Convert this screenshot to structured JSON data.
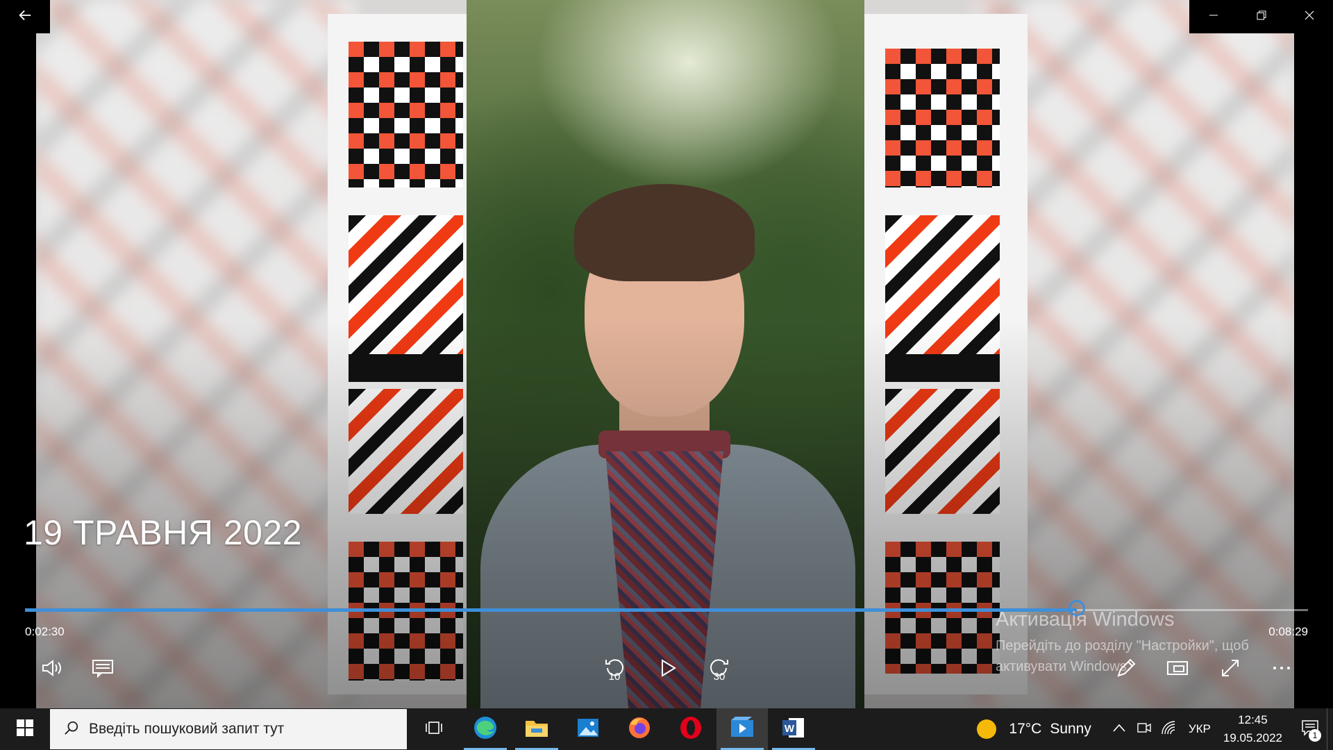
{
  "video": {
    "title": "19 ТРАВНЯ 2022",
    "current_time": "0:02:30",
    "total_time": "0:08:29",
    "progress_fraction": 0.82,
    "accent_color": "#3f8fd8",
    "skip_back_seconds": "10",
    "skip_forward_seconds": "30"
  },
  "window_controls": {
    "back_icon": "arrow-left-icon",
    "minimize_icon": "minimize-icon",
    "restore_icon": "restore-icon",
    "close_icon": "close-icon"
  },
  "player_controls": {
    "volume_icon": "volume-icon",
    "captions_icon": "captions-icon",
    "skip_back_icon": "skip-back-10-icon",
    "play_icon": "play-icon",
    "skip_forward_icon": "skip-forward-30-icon",
    "edit_icon": "pencil-icon",
    "miniview_icon": "mini-view-icon",
    "fullscreen_icon": "fullscreen-icon",
    "more_icon": "more-icon"
  },
  "activation": {
    "title": "Активація Windows",
    "line1": "Перейдіть до розділу \"Настройки\", щоб",
    "line2": "активувати Windows."
  },
  "taskbar": {
    "search_placeholder": "Введіть пошуковий запит тут",
    "apps": [
      "task-view",
      "edge",
      "file-explorer",
      "photos",
      "firefox",
      "opera",
      "movies-tv",
      "word"
    ],
    "weather_temp": "17°C",
    "weather_desc": "Sunny",
    "language": "УКР",
    "time": "12:45",
    "date": "19.05.2022",
    "notification_count": "1"
  }
}
